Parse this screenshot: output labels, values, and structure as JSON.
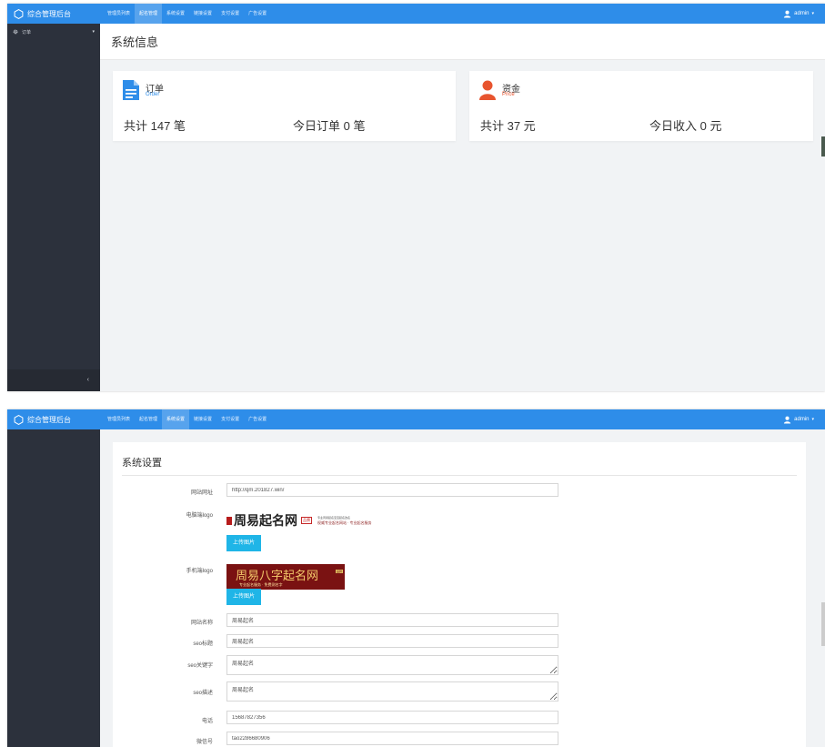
{
  "app": {
    "brand": "综合管理后台",
    "nav": [
      "管理员列表",
      "起名管理",
      "系统设置",
      "链接设置",
      "支付设置",
      "广告设置"
    ],
    "user": "admin"
  },
  "screen1": {
    "active_nav": 1,
    "sidebar": {
      "item_label": "订单",
      "collapse_glyph": "‹"
    },
    "page_title": "系统信息",
    "cards": {
      "order": {
        "name": "订单",
        "sub": "Order",
        "total": "共计 147 笔",
        "today": "今日订单 0 笔",
        "icon_color": "#2e8de9"
      },
      "funds": {
        "name": "资金",
        "sub": "Price",
        "total": "共计 37 元",
        "today": "今日收入 0 元",
        "icon_color": "#e8542e"
      }
    }
  },
  "screen2": {
    "active_nav": 2,
    "panel_title": "系统设置",
    "fields": {
      "site_url": {
        "label": "网站网址",
        "value": "http://qm.201827.win/"
      },
      "pc_logo": {
        "label": "电脑端logo",
        "upload": "上传图片"
      },
      "mobile_logo": {
        "label": "手机端logo",
        "upload": "上传图片"
      },
      "site_name": {
        "label": "网站名称",
        "value": "周易起名"
      },
      "seo_title": {
        "label": "seo标题",
        "value": "周易起名"
      },
      "seo_keywords": {
        "label": "seo关键字",
        "value": "周易起名"
      },
      "seo_desc": {
        "label": "seo描述",
        "value": "周易起名"
      },
      "phone": {
        "label": "电话",
        "value": "15687827356"
      },
      "wechat": {
        "label": "微信号",
        "value": "tao2286680906"
      }
    },
    "pc_logo_image": {
      "title": "周易起名网",
      "seal": "品牌",
      "line1": "专业周易起名宝宝起名改名",
      "line2": "权威专业起名网站 · 专业起名服务"
    },
    "mobile_logo_image": {
      "title": "周易八字起名网",
      "tag": "品牌",
      "sub": "专业起名服务 · 免费测名字"
    }
  }
}
